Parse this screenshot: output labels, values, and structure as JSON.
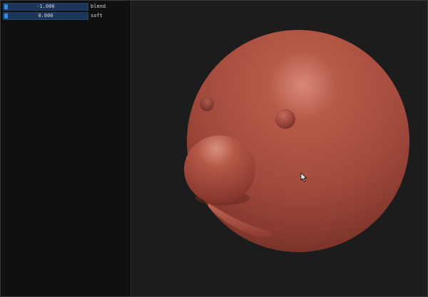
{
  "controls": {
    "sliders": [
      {
        "value_text": "-1.000",
        "label": "blend"
      },
      {
        "value_text": "0.000",
        "label": "soft"
      }
    ]
  },
  "viewport": {
    "object": "sculpted-head-mesh",
    "material_color": "#a84d3f",
    "background_color": "#1c1c1c"
  },
  "icons": {
    "cursor": "arrow-cursor-icon"
  }
}
